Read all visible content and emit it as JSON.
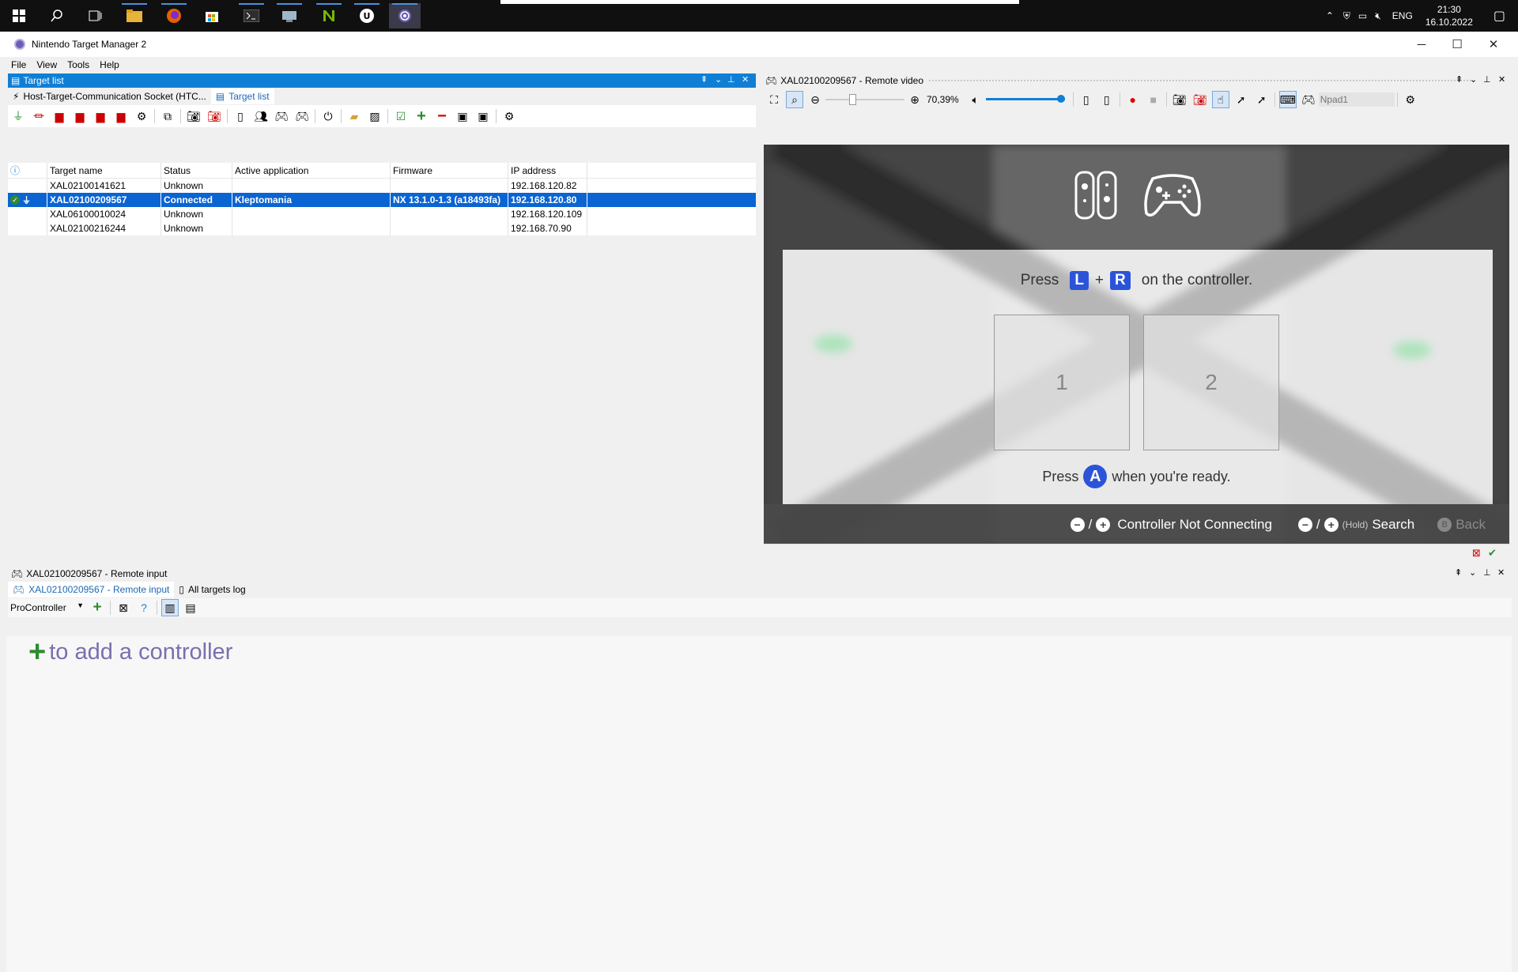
{
  "taskbar": {
    "clock_time": "21:30",
    "clock_date": "16.10.2022",
    "lang": "ENG",
    "icons": [
      "windows-start-icon",
      "search-icon",
      "task-view-icon",
      "file-explorer-icon",
      "firefox-icon",
      "store-icon",
      "terminal-icon",
      "device-manager-icon",
      "nvidia-nsight-icon",
      "unreal-icon",
      "target-manager-icon"
    ]
  },
  "window": {
    "title": "Nintendo Target Manager 2",
    "menu": [
      "File",
      "View",
      "Tools",
      "Help"
    ]
  },
  "target_pane": {
    "header": "Target list",
    "tabs": [
      "Host-Target-Communication Socket (HTC...",
      "Target list"
    ],
    "columns": [
      "Target name",
      "Status",
      "Active application",
      "Firmware",
      "IP address"
    ],
    "rows": [
      {
        "name": "XAL02100141621",
        "status": "Unknown",
        "app": "",
        "firmware": "",
        "ip": "192.168.120.82"
      },
      {
        "name": "XAL02100209567",
        "status": "Connected",
        "app": "Kleptomania",
        "firmware": "NX 13.1.0-1.3 (a18493fa)",
        "ip": "192.168.120.80"
      },
      {
        "name": "XAL06100010024",
        "status": "Unknown",
        "app": "",
        "firmware": "",
        "ip": "192.168.120.109"
      },
      {
        "name": "XAL02100216244",
        "status": "Unknown",
        "app": "",
        "firmware": "",
        "ip": "192.168.70.90"
      }
    ]
  },
  "video_pane": {
    "header": "XAL02100209567 - Remote video",
    "zoom": "70,39%",
    "input_placeholder": "Npad1",
    "volume_fraction": 0.98,
    "screen": {
      "press_prefix": "Press",
      "press_l": "L",
      "press_plus": "+",
      "press_r": "R",
      "press_suffix": "on the controller.",
      "slot1": "1",
      "slot2": "2",
      "ready_prefix": "Press",
      "ready_a": "A",
      "ready_suffix": "when you're ready.",
      "footer_minus": "−",
      "footer_slash1": "/",
      "footer_plus": "+",
      "footer_not_connecting": "Controller Not Connecting",
      "footer_minus2": "−",
      "footer_slash2": "/",
      "footer_plus2": "+",
      "footer_hold": "(Hold)",
      "footer_search": "Search",
      "footer_b": "B",
      "footer_back": "Back"
    }
  },
  "input_pane": {
    "header": "XAL02100209567 - Remote input",
    "tabs": [
      "XAL02100209567 - Remote input",
      "All targets log"
    ],
    "controller_type": "ProController",
    "add_hint": "to add a controller"
  },
  "colors": {
    "accent": "#0f7fd6",
    "selection": "#0a64d2",
    "switch_blue": "#2c54d8",
    "add_green": "#2e8b2e",
    "hint_text": "#7a6fb0"
  }
}
